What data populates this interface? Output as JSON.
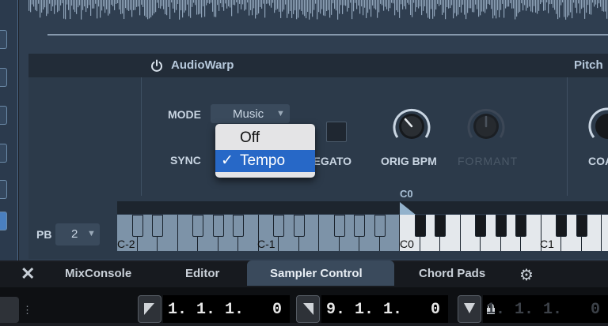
{
  "audiowarp": {
    "title": "AudioWarp",
    "next_section": "Pitch",
    "mode_label": "MODE",
    "mode_value": "Music",
    "sync_label": "SYNC",
    "legato_label": "LEGATO",
    "orig_bpm_label": "ORIG BPM",
    "formant_label": "FORMANT",
    "partial_label": "COA",
    "sync_menu": {
      "options": [
        "Off",
        "Tempo"
      ],
      "selected": "Tempo",
      "check_glyph": "✓"
    }
  },
  "keyboard": {
    "pb_label": "PB",
    "pb_value": "2",
    "marker_label": "C0",
    "octave_labels": [
      "C-2",
      "C-1",
      "C0",
      "C1"
    ]
  },
  "tabs": {
    "items": [
      "MixConsole",
      "Editor",
      "Sampler Control",
      "Chord Pads"
    ],
    "active": "Sampler Control"
  },
  "transport": {
    "position_1": "1. 1. 1.   0",
    "position_2": "9. 1. 1.   0",
    "position_3": "1. 1. 1.   0"
  },
  "colors": {
    "panel": "#2f3e50",
    "header": "#222c38",
    "menu_highlight": "#2768c7",
    "label": "#c9d5e2"
  }
}
